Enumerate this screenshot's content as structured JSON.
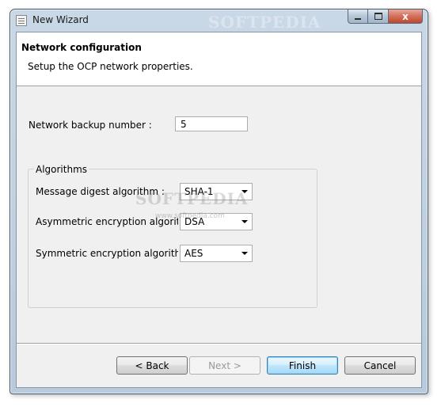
{
  "window": {
    "title": "New Wizard",
    "watermark": "SOFTPEDIA",
    "controls": {
      "minimize": "",
      "maximize": "",
      "close": "x"
    }
  },
  "header": {
    "title": "Network configuration",
    "description": "Setup the OCP network properties."
  },
  "form": {
    "backup_label": "Network backup number :",
    "backup_value": "5",
    "algorithms": {
      "legend": "Algorithms",
      "rows": [
        {
          "label": "Message digest algorithm :",
          "value": "SHA-1"
        },
        {
          "label": "Asymmetric encryption algorithm :",
          "value": "DSA"
        },
        {
          "label": "Symmetric encryption algorithm :",
          "value": "AES"
        }
      ]
    },
    "watermark": "SOFTPEDIA",
    "watermark_url": "www.softpedia.com"
  },
  "buttons": {
    "back": "< Back",
    "next": "Next >",
    "finish": "Finish",
    "cancel": "Cancel"
  },
  "colors": {
    "default_button_border": "#3c7fb1",
    "close_button": "#c0452c",
    "window_frame": "#b8cadb"
  }
}
